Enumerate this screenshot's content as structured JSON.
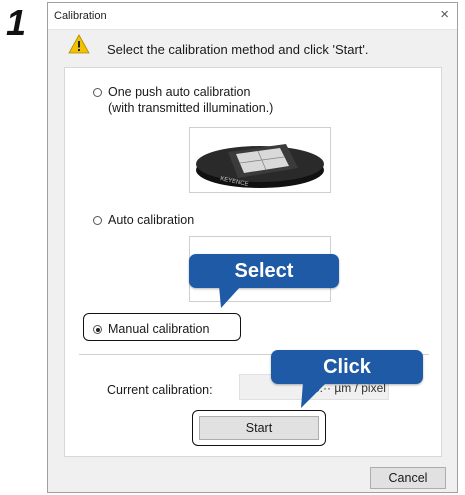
{
  "step_number": "1",
  "window": {
    "title": "Calibration",
    "close_glyph": "×"
  },
  "instruction": {
    "icon": "warning-icon",
    "text": "Select the calibration method and click 'Start'."
  },
  "options": {
    "one_push": {
      "line1": "One push auto calibration",
      "line2": "(with transmitted illumination.)",
      "checked": false
    },
    "auto": {
      "label": "Auto calibration",
      "checked": false
    },
    "manual": {
      "label": "Manual calibration",
      "checked": true
    }
  },
  "plate_logo": "KEYENCE",
  "current": {
    "label": "Current calibration:",
    "value_visible": "5.·· µm / pixel"
  },
  "buttons": {
    "start": "Start",
    "cancel": "Cancel"
  },
  "callouts": {
    "select": "Select",
    "click": "Click"
  },
  "colors": {
    "callout_bg": "#1f5aa6",
    "dialog_bg": "#f0f0f0",
    "warning": "#f2c200"
  }
}
